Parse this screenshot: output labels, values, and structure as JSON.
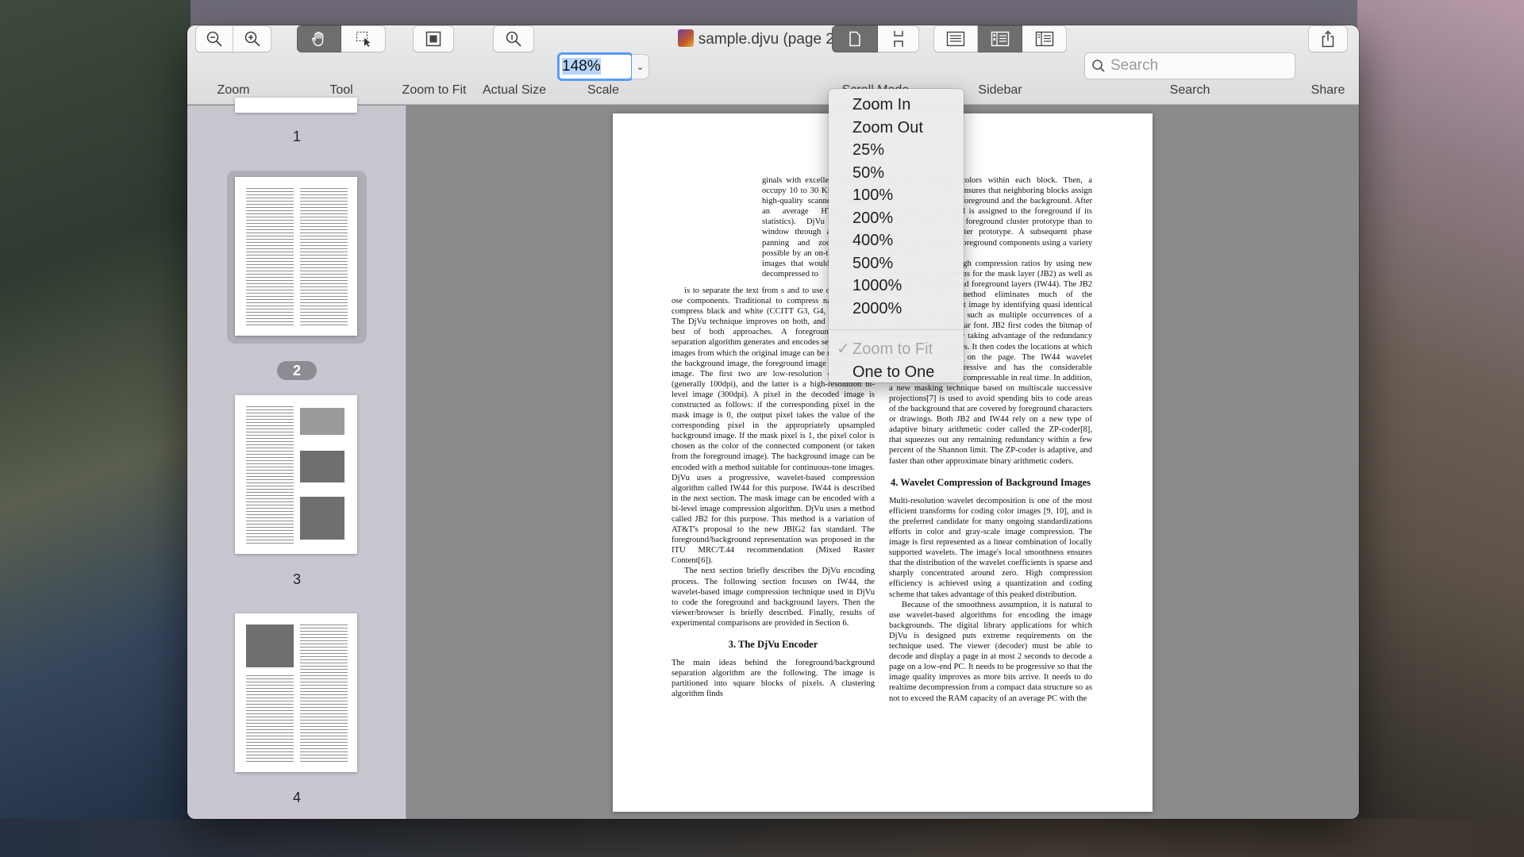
{
  "window": {
    "title": "sample.djvu (page 2 of 4)"
  },
  "toolbar": {
    "zoom_label": "Zoom",
    "tool_label": "Tool",
    "zoom_to_fit_label": "Zoom to Fit",
    "actual_size_label": "Actual Size",
    "scale_label": "Scale",
    "scale_value": "148%",
    "scroll_mode_label": "Scroll Mode",
    "sidebar_label": "Sidebar",
    "search_label": "Search",
    "search_placeholder": "Search",
    "share_label": "Share"
  },
  "scale_menu": {
    "items": [
      "Zoom In",
      "Zoom Out",
      "25%",
      "50%",
      "100%",
      "200%",
      "400%",
      "500%",
      "1000%",
      "2000%"
    ],
    "fit_item": "Zoom to Fit",
    "one_to_one_item": "One to One"
  },
  "sidebar": {
    "pages": [
      "1",
      "2",
      "3",
      "4"
    ],
    "selected_page": "2"
  },
  "document": {
    "left_col": {
      "p1": "ginals with excellent quality. ly occupy 10 to 30 KB once ize of high-quality scanned mitude as an average HTML latest statistics). DjVu pages ser window through a plug- easy panning and zooming made possible by an on-the- ch allows images that would RAM once decompressed to",
      "p2": "is to separate the text from s and to use different tech- ose components. Traditional to compress natural images compress black and white (CCITT G3, G4, and JBIG-1). The DjVu technique improves on both, and combines the best of both approaches. A foreground/background separation algorithm generates and encodes separately three images from which the original image can be reconstructed: the background image, the foreground image and the mask image. The first two are low-resolution color images (generally 100dpi), and the latter is a high-resolution bi-level image (300dpi). A pixel in the decoded image is constructed as follows: if the corresponding pixel in the mask image is 0, the output pixel takes the value of the corresponding pixel in the appropriately upsampled background image. If the mask pixel is 1, the pixel color is chosen as the color of the connected component (or taken from the foreground image). The background image can be encoded with a method suitable for continuous-tone images. DjVu uses a progressive, wavelet-based compression algorithm called IW44 for this purpose. IW44 is described in the next section. The mask image can be encoded with a bi-level image compression algorithm. DjVu uses a method called JB2 for this purpose. This method is a variation of AT&T's proposal to the new JBIG2 fax standard. The foreground/background representation was proposed in the ITU MRC/T.44 recommendation (Mixed Raster Content[6]).",
      "p3": "The next section briefly describes the DjVu encoding process. The following section focuses on IW44, the wavelet-based image compression technique used in DjVu to code the foreground and background layers. Then the viewer/browser is briefly described. Finally, results of experimental comparisons are provided in Section 6.",
      "h3": "3.  The DjVu Encoder",
      "p4": "The main ideas behind the foreground/background separation algorithm are the following. The image is partitioned into square blocks of pixels. A clustering algorithm finds"
    },
    "right_col": {
      "p1": "the two dominant colors within each block. Then, a relaxation algorithm ensures that neighboring blocks assign similar colors to the foreground and the background. After this phase, each pixel is assigned to the foreground if its color is closer to the foreground cluster prototype than to the background cluster prototype. A subsequent phase cleans up and filters foreground components using a variety of criteria.",
      "p2": "DjVu achieves high compression ratios by using new compression algorithms for the mask layer (JB2) as well as for the background and foreground layers (IW44). The JB2 bilevel encoding method eliminates much of the redundancy in the text image by identifying quasi identical shapes on the page, such as multiple occurrences of a character in a particular font. JB2 first codes the bitmap of each unique shape by taking advantage of the redundancy between similar shapes. It then codes the locations at which each shape appears on the page. The IW44 wavelet compressor is progressive and has the considerable advantage of being decompressable in real time. In addition, a new masking technique based on multiscale successive projections[7] is used to avoid spending bits to code areas of the background that are covered by foreground characters or drawings. Both JB2 and IW44 rely on a new type of adaptive binary arithmetic coder called the ZP-coder[8], that squeezes out any remaining redundancy within a few percent of the Shannon limit. The ZP-coder is adaptive, and faster than other approximate binary arithmetic coders.",
      "h3": "4.  Wavelet Compression of Background Images",
      "p3": "Multi-resolution wavelet decomposition is one of the most efficient transforms for coding color images [9, 10], and is the preferred candidate for many ongoing standardizations efforts in color and gray-scale image compression. The image is first represented as a linear combination of locally supported wavelets. The image's local smoothness ensures that the distribution of the wavelet coefficients is sparse and sharply concentrated around zero. High compression efficiency is achieved using a quantization and coding scheme that takes advantage of this peaked distribution.",
      "p4": "Because of the smoothness assumption, it is natural to use wavelet-based algorithms for encoding the image backgrounds. The digital library applications for which DjVu is designed puts extreme requirements on the technique used. The viewer (decoder) must be able to decode and display a page in at most 2 seconds to decode a page on a low-end PC. It needs to be progressive so that the image quality improves as more bits arrive. It needs to do realtime decompression from a compact data structure so as not to exceed the RAM capacity of an average PC with the"
    }
  }
}
